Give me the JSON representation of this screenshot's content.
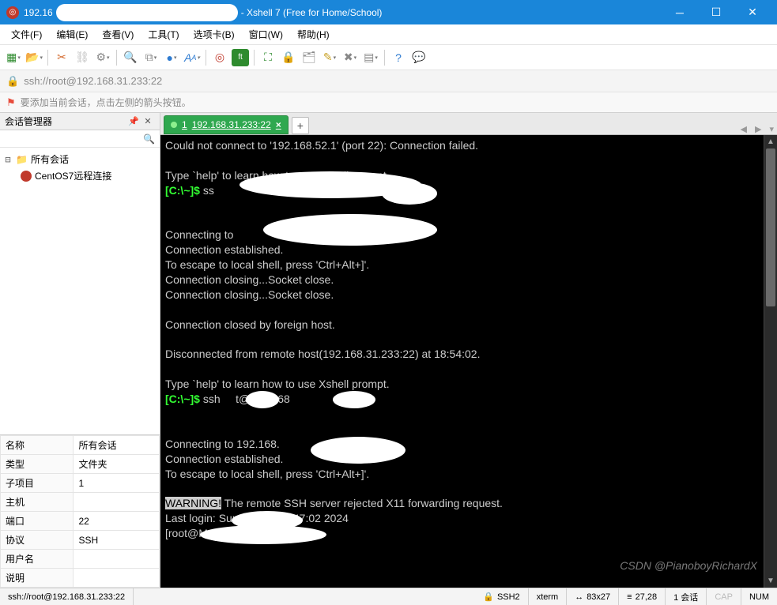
{
  "window": {
    "title_prefix": "192.16",
    "title_suffix": "- Xshell 7 (Free for Home/School)"
  },
  "menu": [
    "文件(F)",
    "编辑(E)",
    "查看(V)",
    "工具(T)",
    "选项卡(B)",
    "窗口(W)",
    "帮助(H)"
  ],
  "address": "ssh://root@192.168.31.233:22",
  "hint": "要添加当前会话，点击左侧的箭头按钮。",
  "panel_title": "会话管理器",
  "tree": {
    "root": "所有会话",
    "child": "CentOS7远程连接"
  },
  "props_header": {
    "name": "名称",
    "value": "所有会话"
  },
  "props": [
    {
      "k": "类型",
      "v": "文件夹"
    },
    {
      "k": "子项目",
      "v": "1"
    },
    {
      "k": "主机",
      "v": ""
    },
    {
      "k": "端口",
      "v": "22"
    },
    {
      "k": "协议",
      "v": "SSH"
    },
    {
      "k": "用户名",
      "v": ""
    },
    {
      "k": "说明",
      "v": ""
    }
  ],
  "tab": {
    "index": "1",
    "label": "192.168.31.233:22"
  },
  "terminal_lines": [
    {
      "t": "Could not connect to '192.168.52.1' (port 22): Connection failed."
    },
    {
      "t": ""
    },
    {
      "t": "Type `help' to learn how to use Xshell prompt."
    },
    {
      "prompt": "[C:\\~]$ ",
      "after": "ss"
    },
    {
      "t": ""
    },
    {
      "t": ""
    },
    {
      "t": "Connecting to "
    },
    {
      "t": "Connection established."
    },
    {
      "t": "To escape to local shell, press 'Ctrl+Alt+]'."
    },
    {
      "t": "Connection closing...Socket close."
    },
    {
      "t": "Connection closing...Socket close."
    },
    {
      "t": ""
    },
    {
      "t": "Connection closed by foreign host."
    },
    {
      "t": ""
    },
    {
      "t": "Disconnected from remote host(192.168.31.233:22) at 18:54:02."
    },
    {
      "t": ""
    },
    {
      "t": "Type `help' to learn how to use Xshell prompt."
    },
    {
      "prompt": "[C:\\~]$ ",
      "after": "ssh     t@192.168"
    },
    {
      "t": ""
    },
    {
      "t": ""
    },
    {
      "t": "Connecting to 192.168."
    },
    {
      "t": "Connection established."
    },
    {
      "t": "To escape to local shell, press 'Ctrl+Alt+]'."
    },
    {
      "t": ""
    },
    {
      "warn": "WARNING!",
      "after": " The remote SSH server rejected X11 forwarding request."
    },
    {
      "t": "Last login: Sun Jun 23 18:47:02 2024"
    },
    {
      "root": "[root@M               ~]# ",
      "cursor": true
    }
  ],
  "status": {
    "addr": "ssh://root@192.168.31.233:22",
    "proto": "SSH2",
    "term": "xterm",
    "size": "83x27",
    "pos": "27,28",
    "sess": "1 会话",
    "cap": "CAP",
    "num": "NUM",
    "watermark": "CSDN @PianoboyRichardX"
  }
}
